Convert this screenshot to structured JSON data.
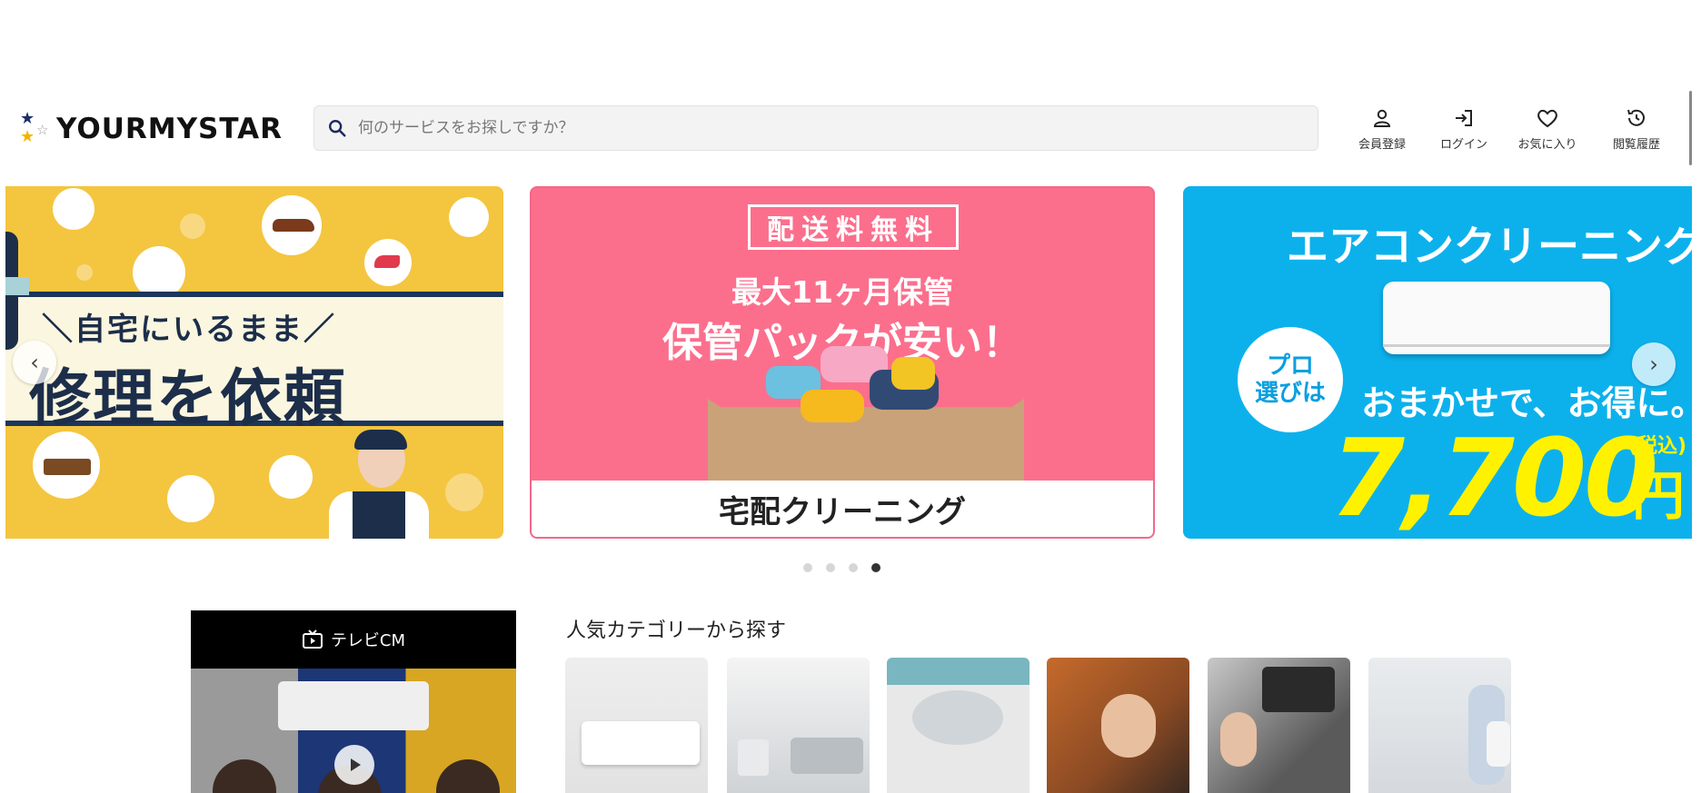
{
  "header": {
    "logo_text": "YOURMYSTAR",
    "search_placeholder": "何のサービスをお探しですか？",
    "nav": [
      {
        "label": "会員登録",
        "icon": "user-icon"
      },
      {
        "label": "ログイン",
        "icon": "login-icon"
      },
      {
        "label": "お気に入り",
        "icon": "heart-icon"
      },
      {
        "label": "閲覧履歴",
        "icon": "history-icon"
      }
    ]
  },
  "carousel": {
    "slides": [
      {
        "sub": "＼自宅にいるまま／",
        "main": "修理を依頼"
      },
      {
        "badge": "配送料無料",
        "line1": "最大11ヶ月保管",
        "line2": "保管パックが安い！",
        "band": "宅配クリーニング"
      },
      {
        "title": "エアコンクリーニング",
        "bubble1": "プロ",
        "bubble2": "選びは",
        "sub": "おまかせで、お得に。",
        "price": "7,700",
        "yen": "円",
        "tax": "(税込)"
      }
    ],
    "prev_glyph": "‹",
    "next_glyph": "›",
    "page_count": 4,
    "active_page": 4
  },
  "tvcm": {
    "label": "テレビCM"
  },
  "categories": {
    "title": "人気カテゴリーから探す"
  },
  "colors": {
    "accent_blue": "#0cb1ec",
    "pink": "#fb6f8c",
    "yellow": "#f4c53f",
    "navy": "#1c355b"
  }
}
